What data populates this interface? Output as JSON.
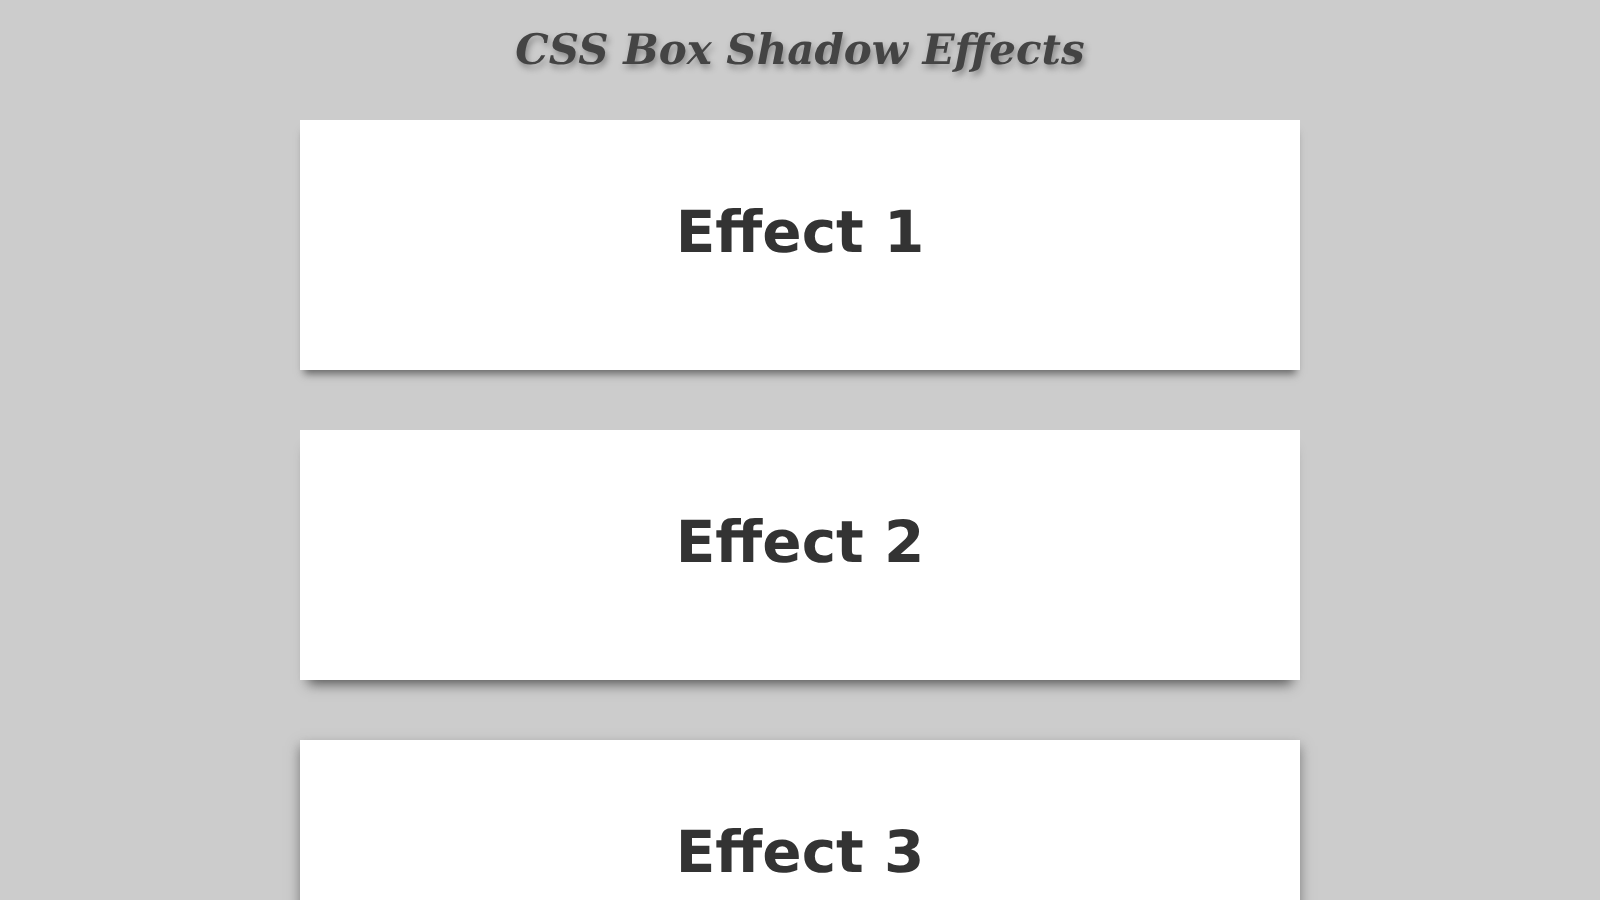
{
  "title": "CSS Box Shadow Effects",
  "cards": [
    {
      "label": "Effect 1"
    },
    {
      "label": "Effect 2"
    },
    {
      "label": "Effect 3"
    }
  ]
}
